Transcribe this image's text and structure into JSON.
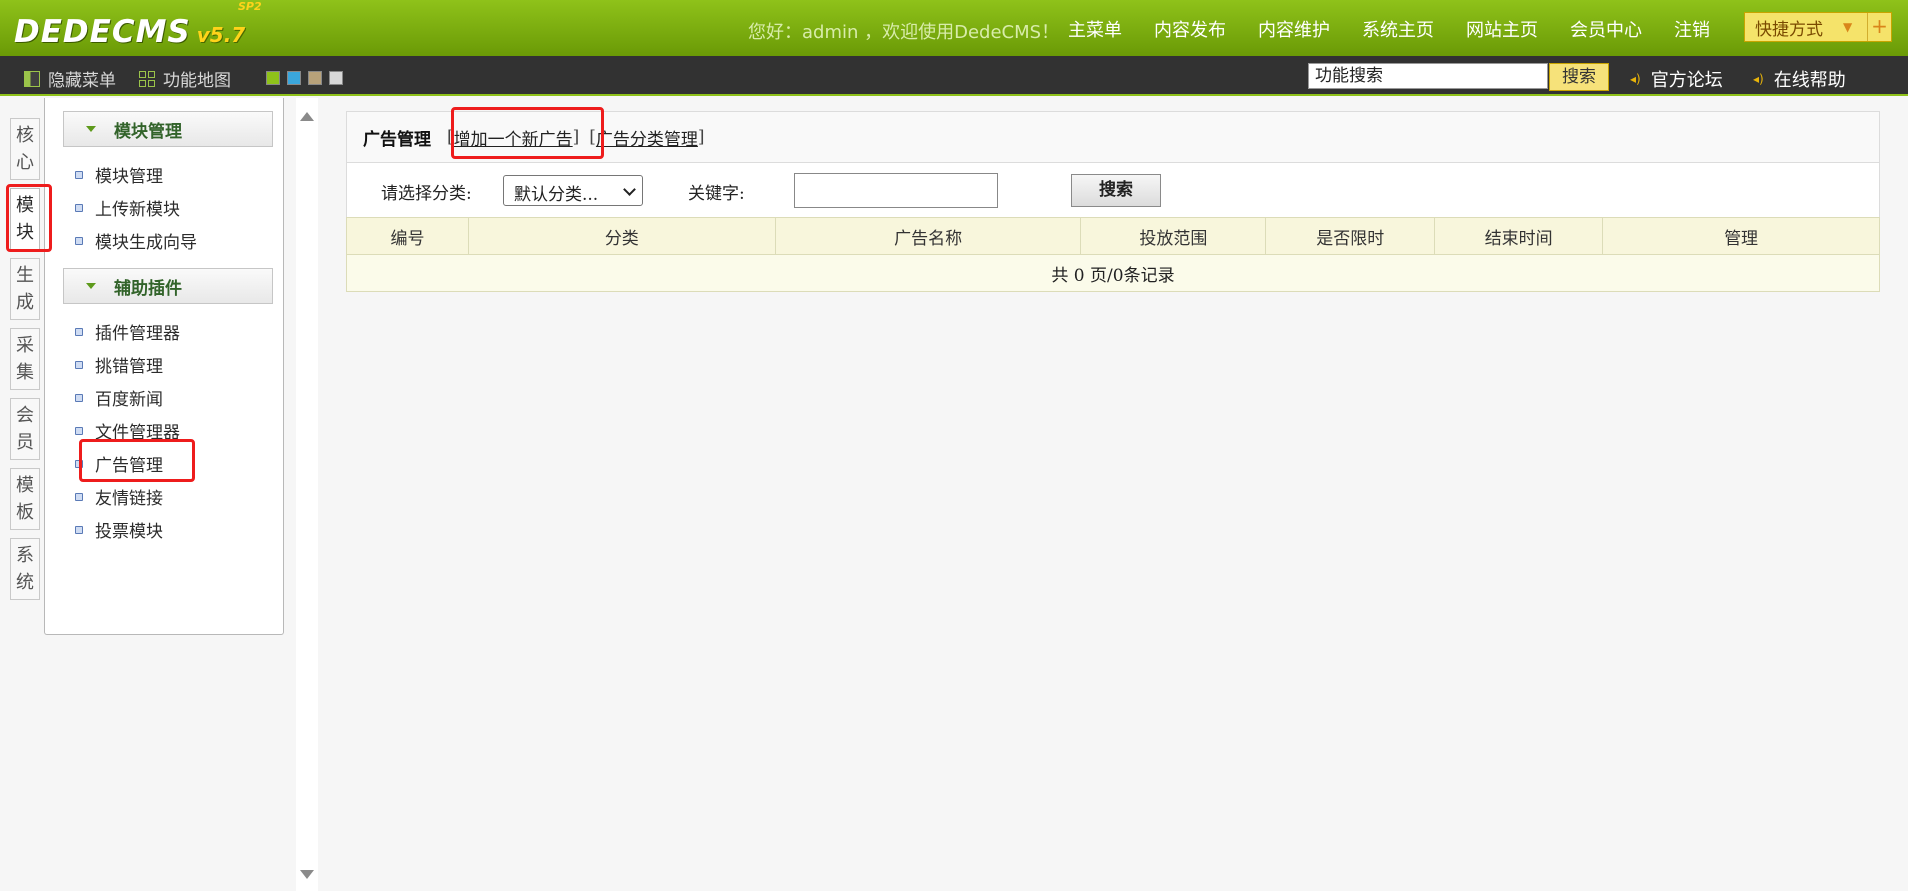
{
  "app": {
    "logo": "DEDECMS",
    "version": "v5.7",
    "version_tag": "SP2",
    "welcome": "您好：admin ，欢迎使用DedeCMS！",
    "top_nav": [
      "主菜单",
      "内容发布",
      "内容维护",
      "系统主页",
      "网站主页",
      "会员中心",
      "注销"
    ],
    "quick_menu": "快捷方式",
    "quick_add": "+",
    "brand_color": "#7aac0e"
  },
  "subbar": {
    "hide_menu": "隐藏菜单",
    "function_map": "功能地图",
    "skins": [
      "#8fc21a",
      "#3aa6dc",
      "#b8a27a",
      "#d8d8d8"
    ],
    "search_value": "功能搜索",
    "search_button": "搜索",
    "forum": "官方论坛",
    "help": "在线帮助"
  },
  "side_tabs": [
    {
      "label": [
        "核",
        "心"
      ],
      "active": false
    },
    {
      "label": [
        "模",
        "块"
      ],
      "active": true
    },
    {
      "label": [
        "生",
        "成"
      ],
      "active": false
    },
    {
      "label": [
        "采",
        "集"
      ],
      "active": false
    },
    {
      "label": [
        "会",
        "员"
      ],
      "active": false
    },
    {
      "label": [
        "模",
        "板"
      ],
      "active": false
    },
    {
      "label": [
        "系",
        "统"
      ],
      "active": false
    }
  ],
  "menu": {
    "groups": [
      {
        "title": "模块管理",
        "items": [
          "模块管理",
          "上传新模块",
          "模块生成向导"
        ]
      },
      {
        "title": "辅助插件",
        "items": [
          "插件管理器",
          "挑错管理",
          "百度新闻",
          "文件管理器",
          "广告管理",
          "友情链接",
          "投票模块"
        ]
      }
    ]
  },
  "main": {
    "title": "广告管理",
    "links": [
      "增加一个新广告",
      "广告分类管理"
    ],
    "filter": {
      "category_label": "请选择分类:",
      "category_value": "默认分类...",
      "keyword_label": "关键字:",
      "keyword_value": "",
      "search_button": "搜索"
    },
    "table": {
      "headers": [
        "编号",
        "分类",
        "广告名称",
        "投放范围",
        "是否限时",
        "结束时间",
        "管理"
      ],
      "footer": "共 0 页/0条记录"
    }
  },
  "highlight_color": "#ee1c1c"
}
